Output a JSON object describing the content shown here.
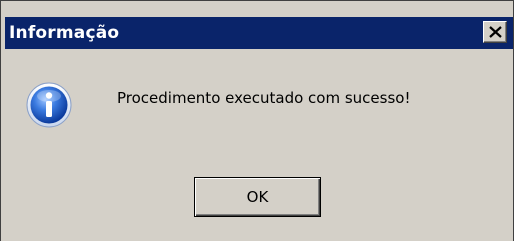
{
  "window": {
    "title": "Informação",
    "close_symbol": "✕"
  },
  "dialog": {
    "icon": "info-icon",
    "message": "Procedimento executado com sucesso!",
    "ok_label": "OK"
  },
  "colors": {
    "titlebar": "#0a246a",
    "face": "#d4d0c8",
    "icon_blue": "#1f5fbf",
    "title_text": "#ffffff"
  }
}
